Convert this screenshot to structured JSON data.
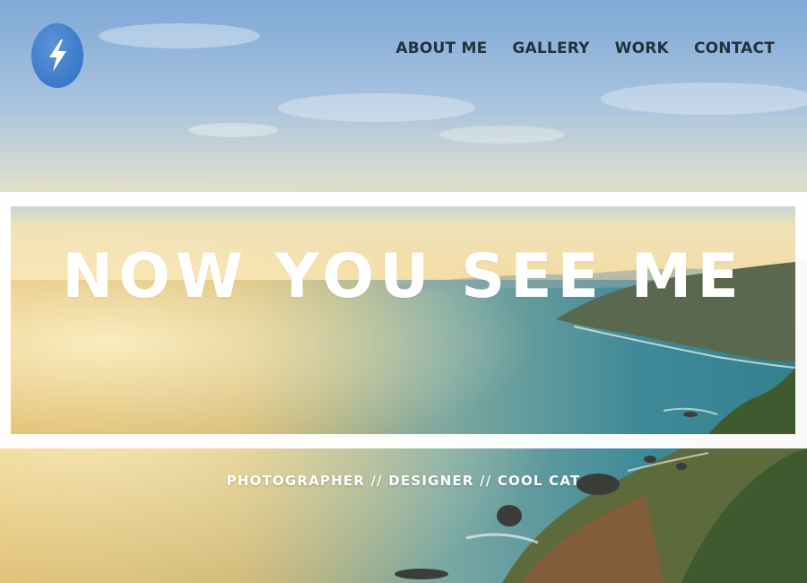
{
  "brand": {
    "logo_icon": "lightning-bolt-icon",
    "logo_color": "#4a86cf"
  },
  "nav": {
    "items": [
      {
        "label": "ABOUT ME"
      },
      {
        "label": "GALLERY"
      },
      {
        "label": "WORK"
      },
      {
        "label": "CONTACT"
      }
    ]
  },
  "hero": {
    "title": "NOW YOU SEE ME",
    "tagline": "PHOTOGRAPHER // DESIGNER // COOL CAT"
  },
  "colors": {
    "nav_text": "#24313d",
    "hero_text": "#ffffff",
    "band": "#ffffff"
  }
}
